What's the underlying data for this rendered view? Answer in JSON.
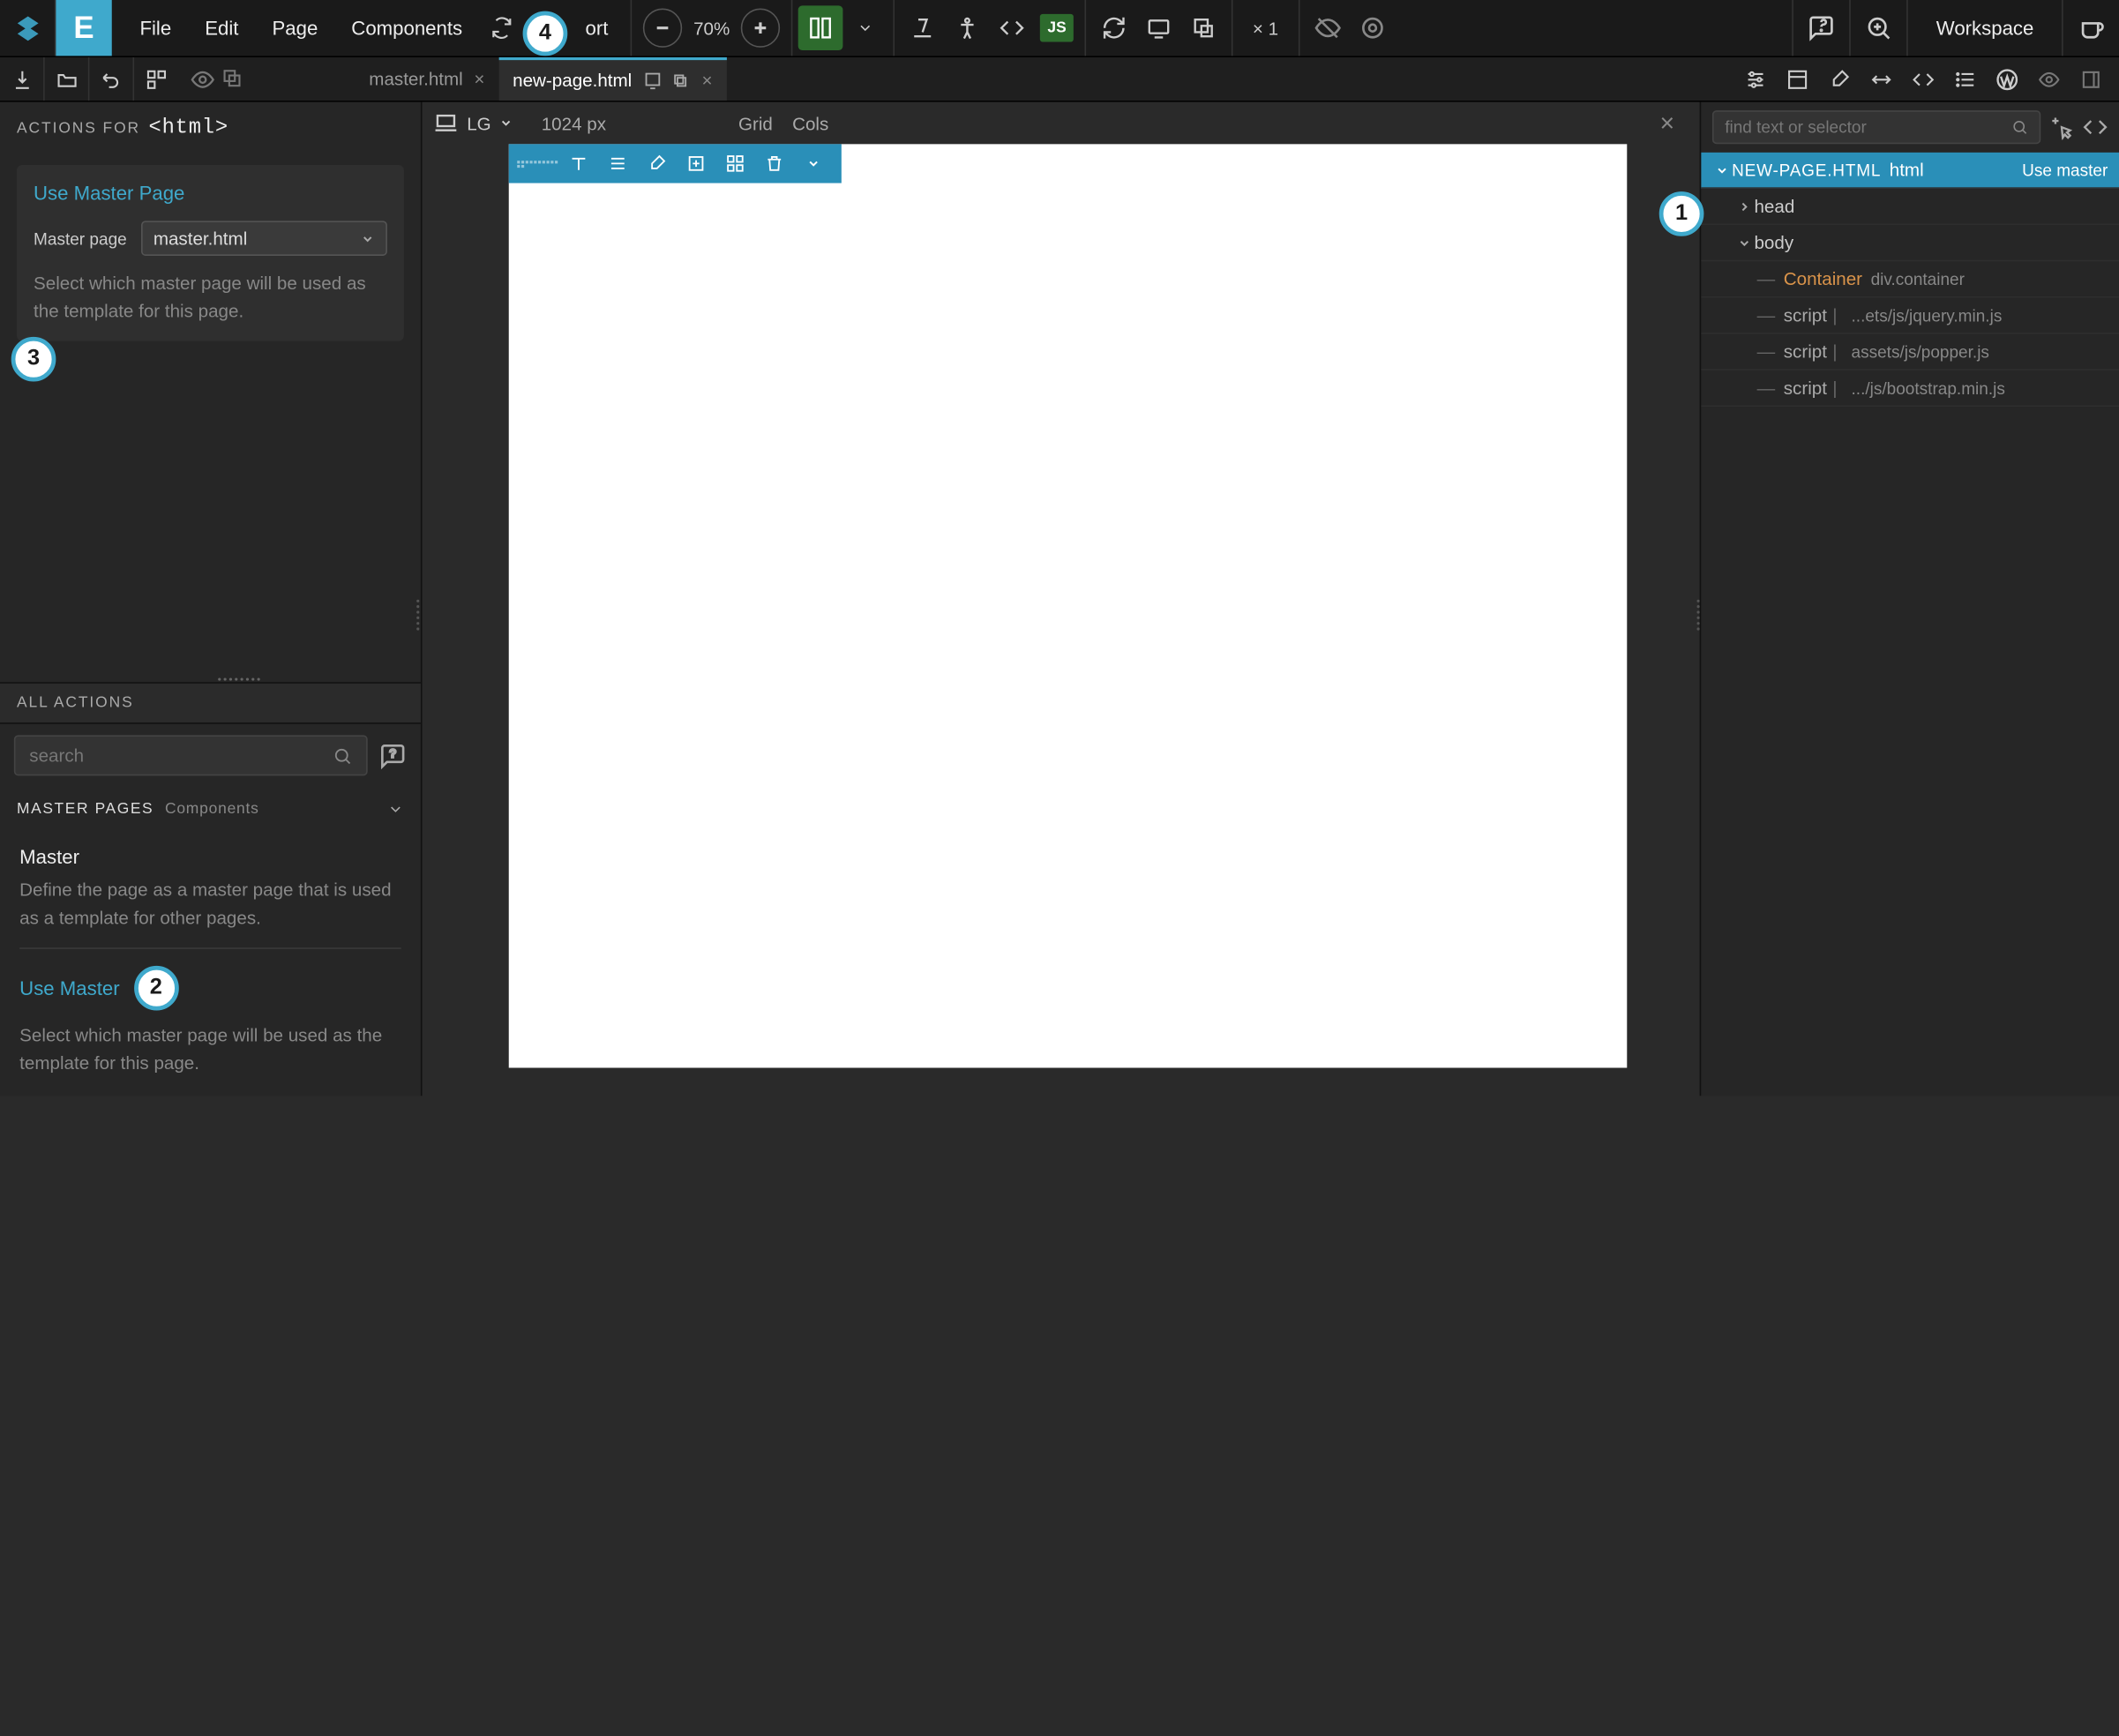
{
  "topMenu": {
    "items": [
      "File",
      "Edit",
      "Page",
      "Components"
    ],
    "ortText": "ort",
    "zoom": "70%",
    "x1": "× 1",
    "workspace": "Workspace"
  },
  "tabs": {
    "inactive": "master.html",
    "active": "new-page.html"
  },
  "leftPanel": {
    "actionsFor": "ACTIONS FOR",
    "htmlTag": "<html>",
    "useMasterTitle": "Use Master Page",
    "masterPageLabel": "Master page",
    "masterSelectValue": "master.html",
    "masterDesc": "Select which master page will be used as the template for this page.",
    "allActions": "ALL ACTIONS",
    "searchPlaceholder": "search",
    "sectionTitle": "MASTER PAGES",
    "sectionSub": "Components",
    "masterItem": {
      "title": "Master",
      "desc": "Define the page as a master page that is used as a template for other pages."
    },
    "useMasterItem": {
      "title": "Use Master",
      "desc": "Select which master page will be used as the template for this page."
    }
  },
  "canvas": {
    "deviceLabel": "LG",
    "pxLabel": "1024 px",
    "grid": "Grid",
    "cols": "Cols"
  },
  "rightPanel": {
    "findPlaceholder": "find text or selector",
    "root": {
      "name": "NEW-PAGE.HTML",
      "tag": "html",
      "badge": "Use master"
    },
    "head": "head",
    "body": "body",
    "container": {
      "name": "Container",
      "meta": "div.container"
    },
    "scripts": [
      {
        "label": "script",
        "path": "...ets/js/jquery.min.js"
      },
      {
        "label": "script",
        "path": "assets/js/popper.js"
      },
      {
        "label": "script",
        "path": ".../js/bootstrap.min.js"
      }
    ]
  },
  "bubbles": {
    "b1": "1",
    "b2": "2",
    "b3": "3",
    "b4": "4"
  }
}
